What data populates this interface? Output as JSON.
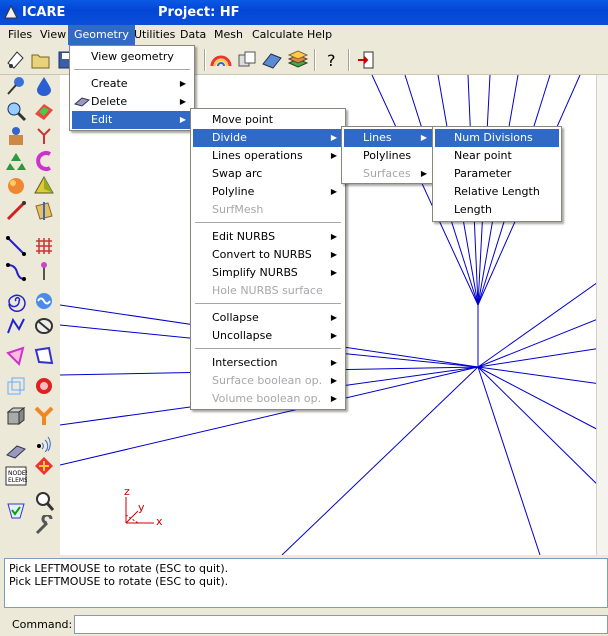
{
  "window": {
    "app_name": "ICARE",
    "project_title": "Project: HF"
  },
  "menubar": [
    "Files",
    "View",
    "Geometry",
    "Utilities",
    "Data",
    "Mesh",
    "Calculate",
    "Help"
  ],
  "geometry_menu": {
    "view_geometry": "View geometry",
    "create": "Create",
    "delete": "Delete",
    "edit": "Edit"
  },
  "edit_menu": {
    "move_point": "Move point",
    "divide": "Divide",
    "lines_operations": "Lines operations",
    "swap_arc": "Swap arc",
    "polyline": "Polyline",
    "surfmesh": "SurfMesh",
    "edit_nurbs": "Edit NURBS",
    "convert_to_nurbs": "Convert to NURBS",
    "simplify_nurbs": "Simplify NURBS",
    "hole_nurbs_surface": "Hole NURBS surface",
    "collapse": "Collapse",
    "uncollapse": "Uncollapse",
    "intersection": "Intersection",
    "surface_boolean_op": "Surface boolean op.",
    "volume_boolean_op": "Volume boolean op."
  },
  "divide_menu": {
    "lines": "Lines",
    "polylines": "Polylines",
    "surfaces": "Surfaces"
  },
  "lines_menu": [
    "Num Divisions",
    "Near point",
    "Parameter",
    "Relative Length",
    "Length"
  ],
  "axis_labels": {
    "z": "z",
    "y": "y",
    "x": "x"
  },
  "messages": [
    "Pick LEFTMOUSE to rotate (ESC to quit).",
    "Pick LEFTMOUSE to rotate (ESC to quit)."
  ],
  "command": {
    "label": "Command:",
    "value": ""
  },
  "toolbar_icons": [
    "point-tool-icon",
    "open-folder-icon",
    "save-icon",
    "rainbow-render-icon",
    "view-icon",
    "surface-icon",
    "layers-icon",
    "help-question-icon",
    "exit-icon"
  ],
  "colors": {
    "accent": "#316ac5",
    "geometry_lines": "#0000cc",
    "axes": "#cc0000"
  }
}
